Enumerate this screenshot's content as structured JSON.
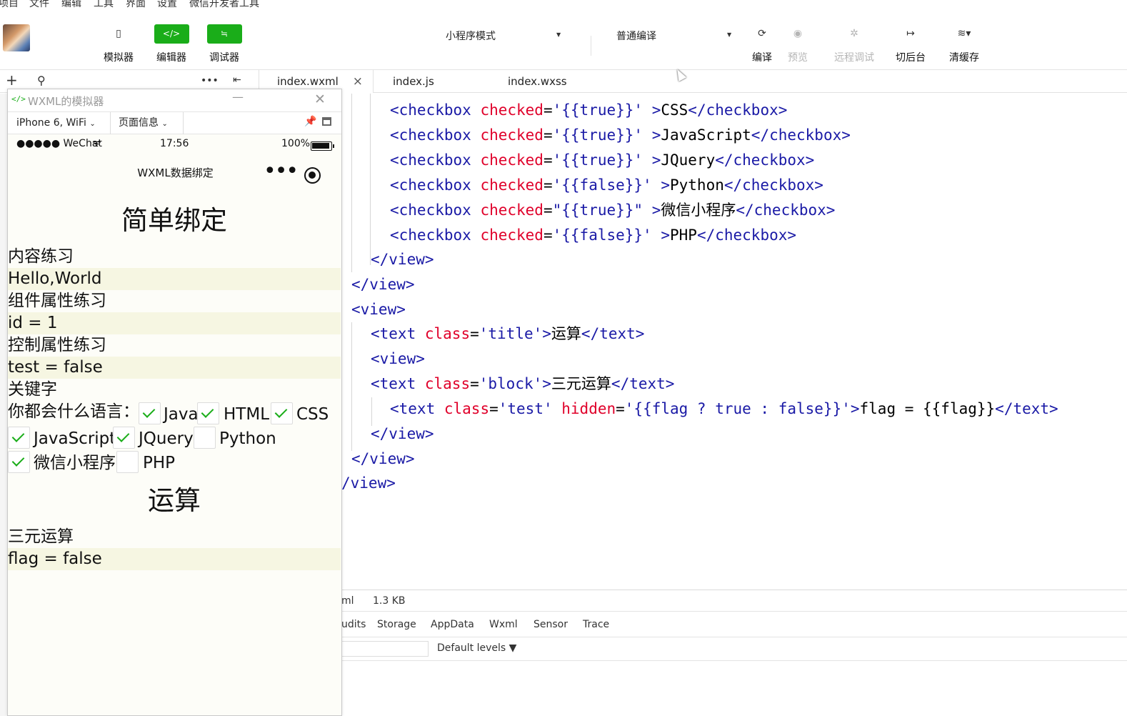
{
  "menubar": [
    "项目",
    "文件",
    "编辑",
    "工具",
    "界面",
    "设置",
    "微信开发者工具"
  ],
  "toolbar": {
    "simulator": "模拟器",
    "editor": "编辑器",
    "debugger": "调试器",
    "mode": "小程序模式",
    "compile_mode": "普通编译",
    "compile": "编译",
    "preview": "预览",
    "remote_debug": "远程调试",
    "background": "切后台",
    "clear_cache": "清缓存",
    "editor_icon": "</>",
    "debugger_icon": "≒"
  },
  "tabs": {
    "wxml": "index.wxml",
    "js": "index.js",
    "wxss": "index.wxss"
  },
  "simulator": {
    "window_title": "WXML的模拟器",
    "device": "iPhone 6, WiFi",
    "page_info": "页面信息",
    "status_carrier": "●●●●● WeChat",
    "status_time": "17:56",
    "status_battery": "100%",
    "nav_title": "WXML数据绑定",
    "nav_dots": "•••",
    "page": {
      "section1_title": "简单绑定",
      "content_label": "内容练习",
      "content_value": "Hello,World",
      "attr_label": "组件属性练习",
      "attr_value": "id = 1",
      "ctrl_label": "控制属性练习",
      "ctrl_value": "test = false",
      "keyword_label": "关键字",
      "question": "你都会什么语言：",
      "checkboxes": [
        {
          "label": "Java",
          "checked": true
        },
        {
          "label": "HTML",
          "checked": true
        },
        {
          "label": "CSS",
          "checked": true
        },
        {
          "label": "JavaScript",
          "checked": true
        },
        {
          "label": "JQuery",
          "checked": true
        },
        {
          "label": "Python",
          "checked": false
        },
        {
          "label": "微信小程序",
          "checked": true
        },
        {
          "label": "PHP",
          "checked": false
        }
      ],
      "section2_title": "运算",
      "ternary_label": "三元运算",
      "ternary_value": "flag = false"
    }
  },
  "code": {
    "l1_tag": "<checkbox",
    "l1_attr": "checked",
    "l1_eq": "=",
    "l1_val": "'{{true}}'",
    "l1_close": " >",
    "l1_text": "CSS",
    "l1_end": "</checkbox>",
    "l2_tag": "<checkbox",
    "l2_attr": "checked",
    "l2_eq": "=",
    "l2_val": "'{{true}}'",
    "l2_close": " >",
    "l2_text": "JavaScript",
    "l2_end": "</checkbox>",
    "l3_tag": "<checkbox",
    "l3_attr": "checked",
    "l3_eq": "=",
    "l3_val": "'{{true}}'",
    "l3_close": " >",
    "l3_text": "JQuery",
    "l3_end": "</checkbox>",
    "l4_tag": "<checkbox",
    "l4_attr": "checked",
    "l4_eq": "=",
    "l4_val": "'{{false}}'",
    "l4_close": " >",
    "l4_text": "Python",
    "l4_end": "</checkbox>",
    "l5_tag": "<checkbox",
    "l5_attr": "checked",
    "l5_eq": "=",
    "l5_val": "\"{{true}}\"",
    "l5_close": " >",
    "l5_text": "微信小程序",
    "l5_end": "</checkbox>",
    "l6_tag": "<checkbox",
    "l6_attr": "checked",
    "l6_eq": "=",
    "l6_val": "'{{false}}'",
    "l6_close": " >",
    "l6_text": "PHP",
    "l6_end": "</checkbox>",
    "l7": "</view>",
    "l8": "</view>",
    "l9": "<view>",
    "l10_tag": "<text",
    "l10_attr": "class",
    "l10_eq": "=",
    "l10_val": "'title'",
    "l10_close": ">",
    "l10_text": "运算",
    "l10_end": "</text>",
    "l11": "<view>",
    "l12_tag": "<text",
    "l12_attr": "class",
    "l12_eq": "=",
    "l12_val": "'block'",
    "l12_close": ">",
    "l12_text": "三元运算",
    "l12_end": "</text>",
    "l13_tag": "<text",
    "l13_attr": "class",
    "l13_eq": "=",
    "l13_val": "'test'",
    "l13_attr2": "hidden",
    "l13_eq2": "=",
    "l13_val2": "'{{flag ? true : false}}'",
    "l13_close": ">",
    "l13_text": "flag = {{flag}}",
    "l13_end": "</text>",
    "l14": "</view>",
    "l15": "</view>",
    "l16": "/view>"
  },
  "bottom": {
    "file_ext": "ml",
    "file_size": "1.3 KB",
    "tabs": [
      "udits",
      "Storage",
      "AppData",
      "Wxml",
      "Sensor",
      "Trace"
    ],
    "levels": "Default levels ▼"
  }
}
